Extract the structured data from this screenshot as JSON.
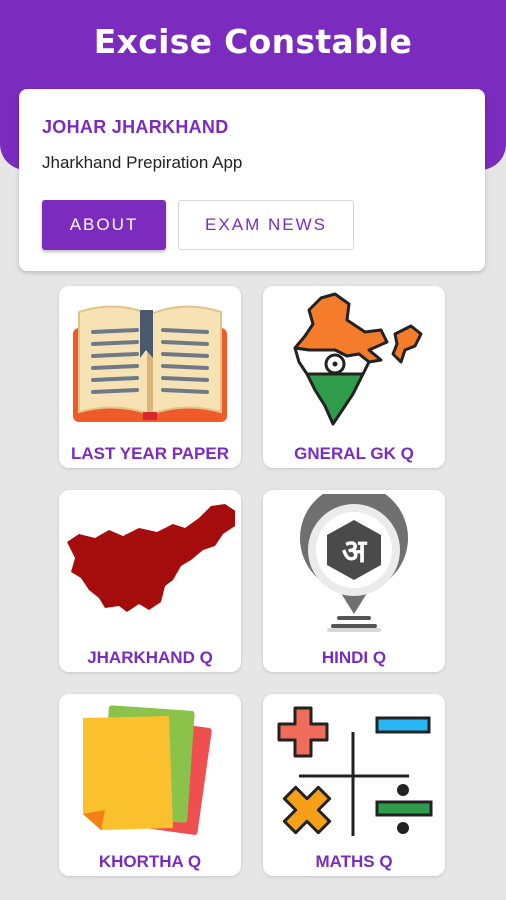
{
  "header": {
    "title": "Excise Constable"
  },
  "card": {
    "title": "JOHAR JHARKHAND",
    "subtitle": "Jharkhand Prepiration App",
    "about_label": "ABOUT",
    "exam_news_label": "EXAM NEWS"
  },
  "tiles": [
    {
      "label": "LAST YEAR PAPER",
      "icon": "open-book-icon"
    },
    {
      "label": "GNERAL GK Q",
      "icon": "india-map-icon"
    },
    {
      "label": "JHARKHAND Q",
      "icon": "jharkhand-map-icon"
    },
    {
      "label": "HINDI Q",
      "icon": "hindi-letter-icon"
    },
    {
      "label": "KHORTHA Q",
      "icon": "papers-icon"
    },
    {
      "label": "MATHS Q",
      "icon": "math-symbols-icon"
    }
  ],
  "colors": {
    "accent": "#7b2cbf",
    "background": "#e6e6e6",
    "card": "#ffffff"
  }
}
